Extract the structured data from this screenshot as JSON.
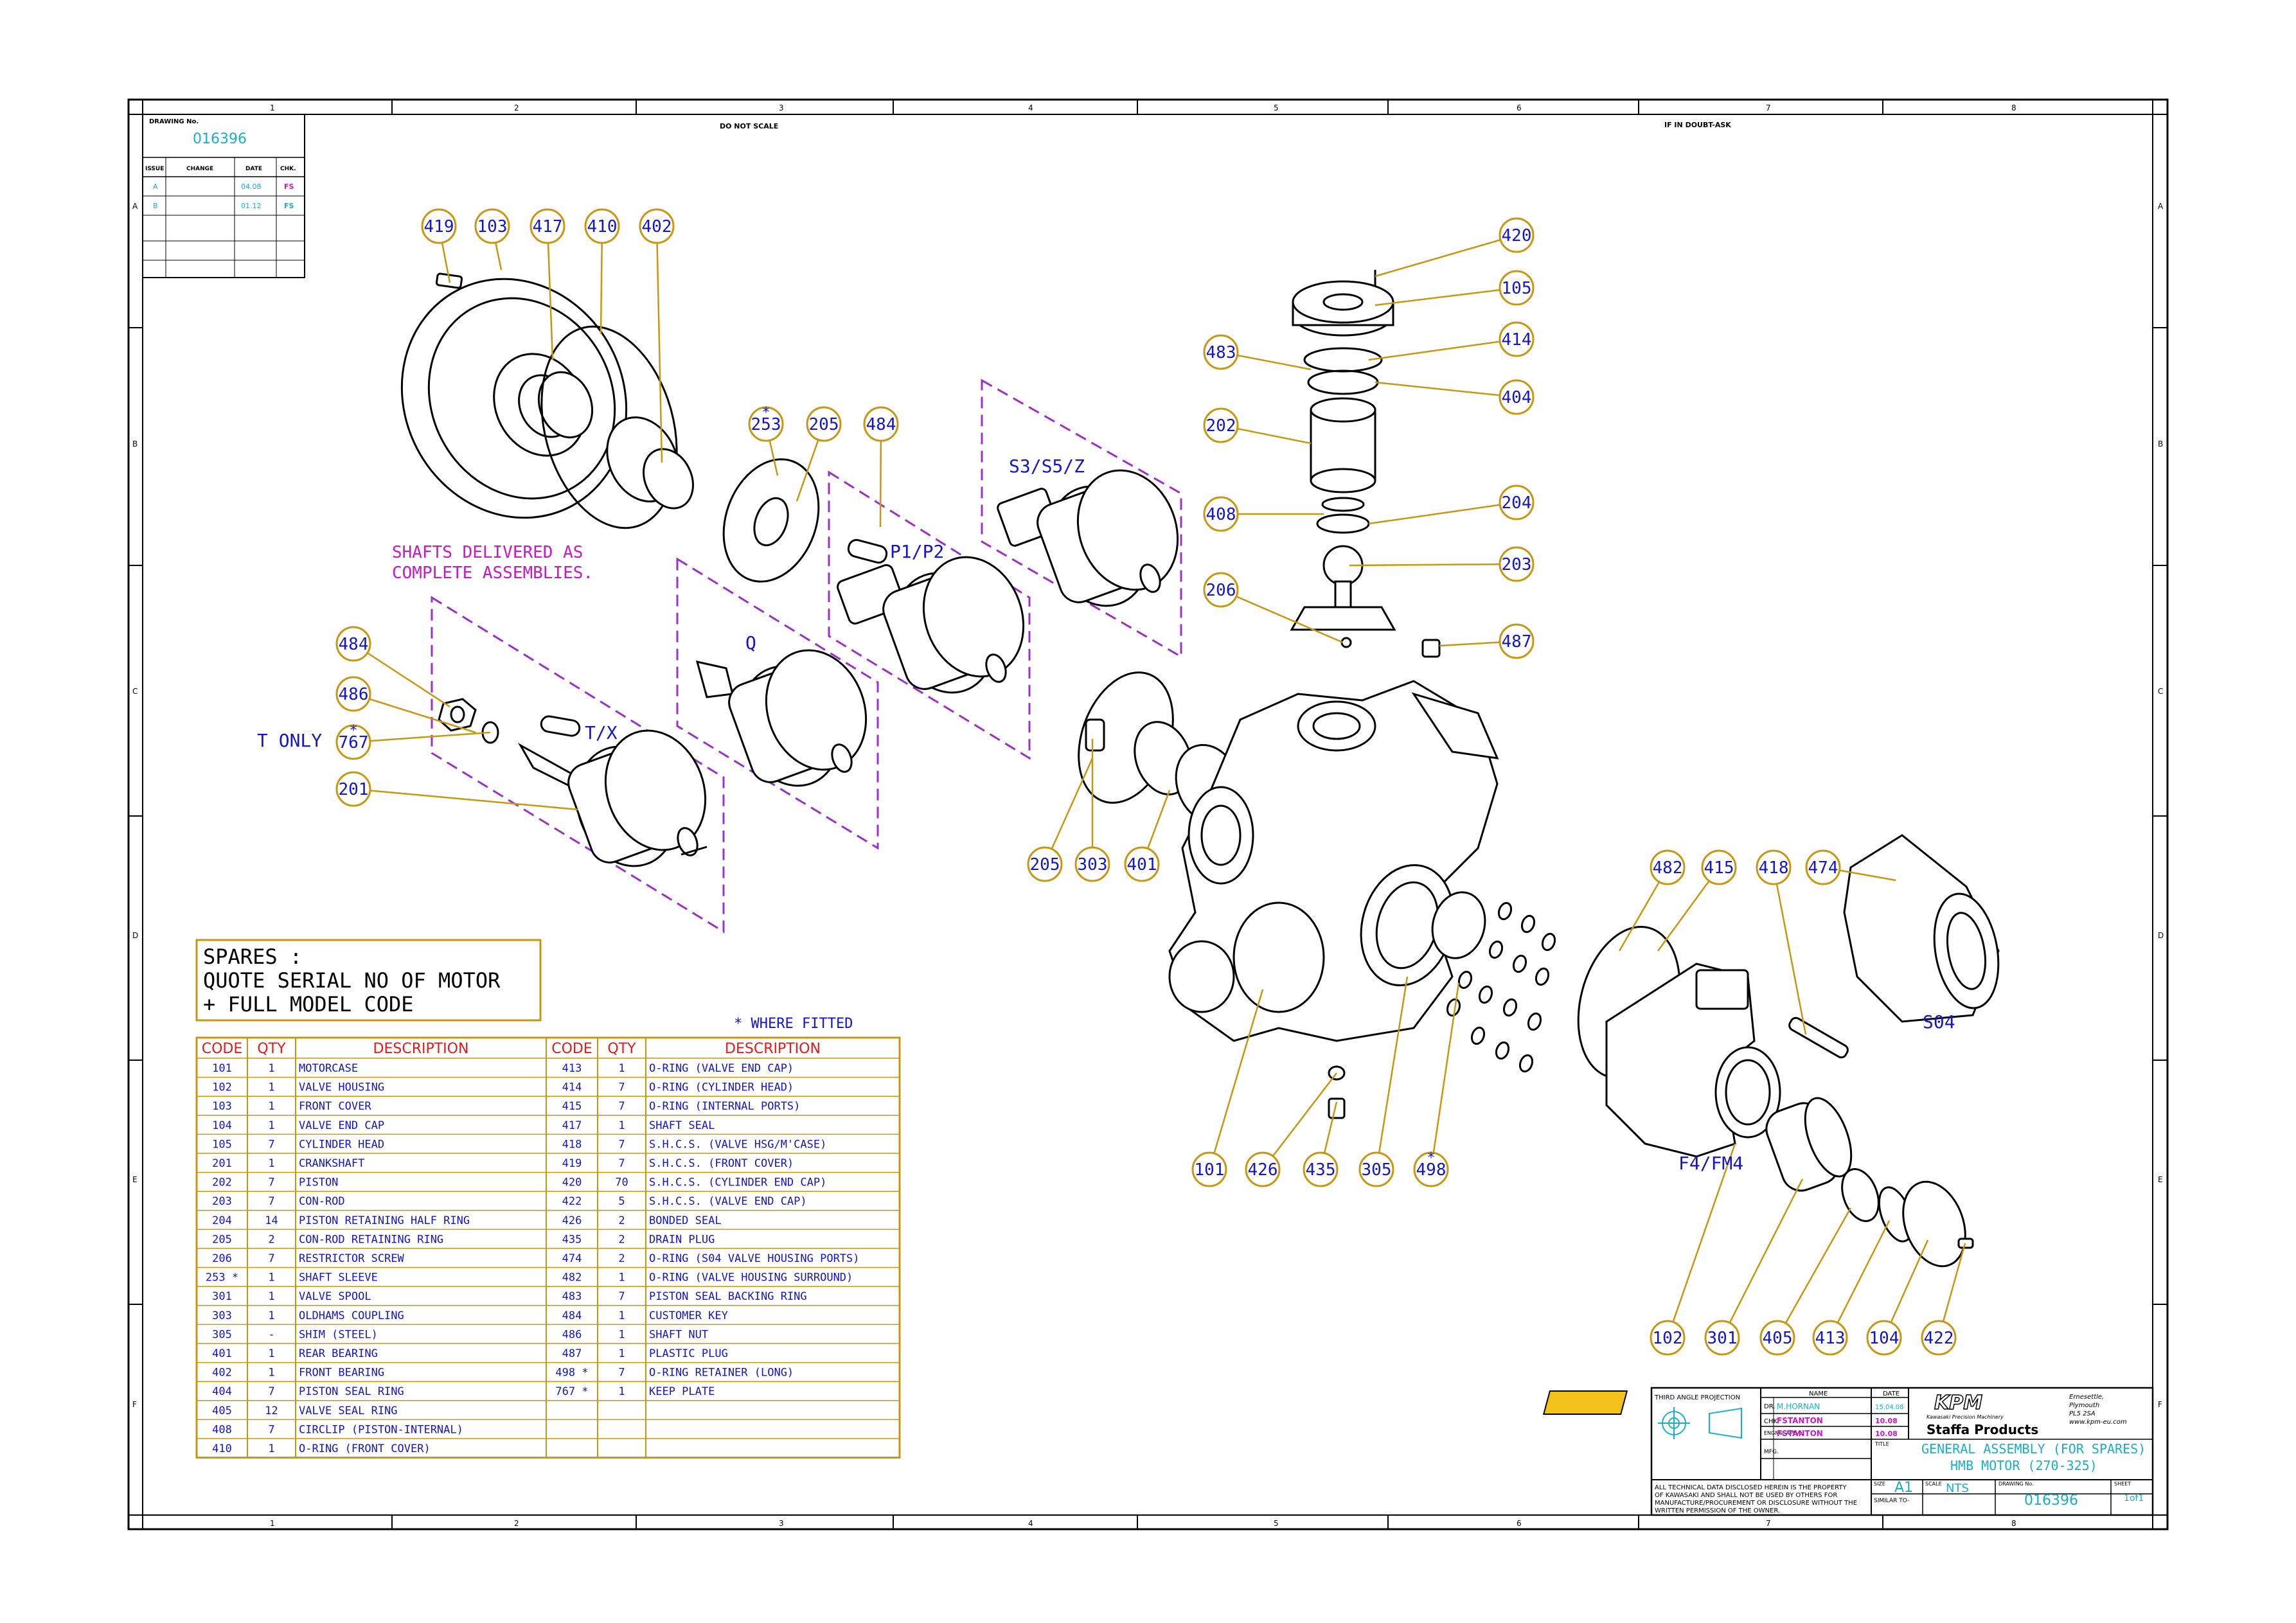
{
  "drawing_no_label": "DRAWING No.",
  "drawing_no": "016396",
  "do_not_scale": "DO NOT SCALE",
  "if_in_doubt": "IF IN DOUBT-ASK",
  "grid_columns": [
    "1",
    "2",
    "3",
    "4",
    "5",
    "6",
    "7",
    "8"
  ],
  "grid_rows": [
    "A",
    "B",
    "C",
    "D",
    "E",
    "F"
  ],
  "revision_headers": [
    "ISSUE",
    "CHANGE",
    "DATE",
    "CHK."
  ],
  "revisions": [
    {
      "issue": "A",
      "change": "",
      "date": "04.08",
      "chk": "FS"
    },
    {
      "issue": "B",
      "change": "",
      "date": "01.12",
      "chk": "FS"
    }
  ],
  "balloons": [
    {
      "id": "419",
      "star": false
    },
    {
      "id": "103",
      "star": false
    },
    {
      "id": "417",
      "star": false
    },
    {
      "id": "410",
      "star": false
    },
    {
      "id": "402",
      "star": false
    },
    {
      "id": "420",
      "star": false
    },
    {
      "id": "105",
      "star": false
    },
    {
      "id": "414",
      "star": false
    },
    {
      "id": "404",
      "star": false
    },
    {
      "id": "483",
      "star": false
    },
    {
      "id": "202",
      "star": false
    },
    {
      "id": "408",
      "star": false
    },
    {
      "id": "204",
      "star": false
    },
    {
      "id": "203",
      "star": false
    },
    {
      "id": "206",
      "star": false
    },
    {
      "id": "487",
      "star": false
    },
    {
      "id": "253",
      "star": true
    },
    {
      "id": "205",
      "star": false
    },
    {
      "id": "484",
      "star": false
    },
    {
      "id": "484",
      "star": false
    },
    {
      "id": "486",
      "star": false
    },
    {
      "id": "767",
      "star": true
    },
    {
      "id": "201",
      "star": false
    },
    {
      "id": "205",
      "star": false
    },
    {
      "id": "303",
      "star": false
    },
    {
      "id": "401",
      "star": false
    },
    {
      "id": "482",
      "star": false
    },
    {
      "id": "415",
      "star": false
    },
    {
      "id": "418",
      "star": false
    },
    {
      "id": "474",
      "star": false
    },
    {
      "id": "101",
      "star": false
    },
    {
      "id": "426",
      "star": false
    },
    {
      "id": "435",
      "star": false
    },
    {
      "id": "305",
      "star": false
    },
    {
      "id": "498",
      "star": true
    },
    {
      "id": "102",
      "star": false
    },
    {
      "id": "301",
      "star": false
    },
    {
      "id": "405",
      "star": false
    },
    {
      "id": "413",
      "star": false
    },
    {
      "id": "104",
      "star": false
    },
    {
      "id": "422",
      "star": false
    }
  ],
  "labels": {
    "shafts_note_1": "SHAFTS DELIVERED AS",
    "shafts_note_2": "COMPLETE ASSEMBLIES.",
    "s3s5z": "S3/S5/Z",
    "p1p2": "P1/P2",
    "q": "Q",
    "tx": "T/X",
    "t_only": "T ONLY",
    "s04": "S04",
    "f4fm4": "F4/FM4",
    "where_fitted": "* WHERE FITTED"
  },
  "spares_box": [
    "SPARES :",
    "QUOTE SERIAL NO OF MOTOR",
    "+ FULL MODEL CODE"
  ],
  "parts_headers": {
    "code": "CODE",
    "qty": "QTY",
    "desc": "DESCRIPTION"
  },
  "parts_left": [
    {
      "code": "101",
      "qty": "1",
      "desc": "MOTORCASE"
    },
    {
      "code": "102",
      "qty": "1",
      "desc": "VALVE HOUSING"
    },
    {
      "code": "103",
      "qty": "1",
      "desc": "FRONT COVER"
    },
    {
      "code": "104",
      "qty": "1",
      "desc": "VALVE END CAP"
    },
    {
      "code": "105",
      "qty": "7",
      "desc": "CYLINDER HEAD"
    },
    {
      "code": "201",
      "qty": "1",
      "desc": "CRANKSHAFT"
    },
    {
      "code": "202",
      "qty": "7",
      "desc": "PISTON"
    },
    {
      "code": "203",
      "qty": "7",
      "desc": "CON-ROD"
    },
    {
      "code": "204",
      "qty": "14",
      "desc": "PISTON RETAINING HALF RING"
    },
    {
      "code": "205",
      "qty": "2",
      "desc": "CON-ROD RETAINING RING"
    },
    {
      "code": "206",
      "qty": "7",
      "desc": "RESTRICTOR SCREW"
    },
    {
      "code": "253 *",
      "qty": "1",
      "desc": "SHAFT SLEEVE"
    },
    {
      "code": "301",
      "qty": "1",
      "desc": "VALVE SPOOL"
    },
    {
      "code": "303",
      "qty": "1",
      "desc": "OLDHAMS COUPLING"
    },
    {
      "code": "305",
      "qty": "-",
      "desc": "SHIM (STEEL)"
    },
    {
      "code": "401",
      "qty": "1",
      "desc": "REAR BEARING"
    },
    {
      "code": "402",
      "qty": "1",
      "desc": "FRONT BEARING"
    },
    {
      "code": "404",
      "qty": "7",
      "desc": "PISTON SEAL RING"
    },
    {
      "code": "405",
      "qty": "12",
      "desc": "VALVE SEAL RING"
    },
    {
      "code": "408",
      "qty": "7",
      "desc": "CIRCLIP (PISTON-INTERNAL)"
    },
    {
      "code": "410",
      "qty": "1",
      "desc": "O-RING (FRONT COVER)"
    }
  ],
  "parts_right": [
    {
      "code": "413",
      "qty": "1",
      "desc": "O-RING (VALVE END CAP)"
    },
    {
      "code": "414",
      "qty": "7",
      "desc": "O-RING (CYLINDER HEAD)"
    },
    {
      "code": "415",
      "qty": "7",
      "desc": "O-RING (INTERNAL PORTS)"
    },
    {
      "code": "417",
      "qty": "1",
      "desc": "SHAFT SEAL"
    },
    {
      "code": "418",
      "qty": "7",
      "desc": "S.H.C.S. (VALVE HSG/M'CASE)"
    },
    {
      "code": "419",
      "qty": "7",
      "desc": "S.H.C.S. (FRONT COVER)"
    },
    {
      "code": "420",
      "qty": "70",
      "desc": "S.H.C.S. (CYLINDER END CAP)"
    },
    {
      "code": "422",
      "qty": "5",
      "desc": "S.H.C.S. (VALVE END CAP)"
    },
    {
      "code": "426",
      "qty": "2",
      "desc": "BONDED SEAL"
    },
    {
      "code": "435",
      "qty": "2",
      "desc": "DRAIN PLUG"
    },
    {
      "code": "474",
      "qty": "2",
      "desc": "O-RING (S04 VALVE HOUSING PORTS)"
    },
    {
      "code": "482",
      "qty": "1",
      "desc": "O-RING (VALVE HOUSING SURROUND)"
    },
    {
      "code": "483",
      "qty": "7",
      "desc": "PISTON SEAL BACKING RING"
    },
    {
      "code": "484",
      "qty": "1",
      "desc": "CUSTOMER KEY"
    },
    {
      "code": "486",
      "qty": "1",
      "desc": "SHAFT NUT"
    },
    {
      "code": "487",
      "qty": "1",
      "desc": "PLASTIC PLUG"
    },
    {
      "code": "498 *",
      "qty": "7",
      "desc": "O-RING RETAINER (LONG)"
    },
    {
      "code": "767 *",
      "qty": "1",
      "desc": "KEEP PLATE"
    },
    {
      "code": "",
      "qty": "",
      "desc": ""
    },
    {
      "code": "",
      "qty": "",
      "desc": ""
    },
    {
      "code": "",
      "qty": "",
      "desc": ""
    }
  ],
  "title_block": {
    "projection": "THIRD ANGLE PROJECTION",
    "name_hdr": "NAME",
    "date_hdr": "DATE",
    "dr_label": "DR.",
    "dr_name": "M.HORNAN",
    "dr_date": "15.04.08",
    "chk_label": "CHK.",
    "chk_name": "FSTANTON",
    "chk_date": "10.08",
    "eng_label": "ENGNG. APPVL.",
    "eng_name": "FSTANTON",
    "eng_date": "10.08",
    "mfg_label": "MFG.",
    "logo": "KPM",
    "logo_sub": "Kawasaki Precision Machinery",
    "company": "Staffa Products",
    "address": [
      "Ernesettle,",
      "Plymouth",
      "PL5 2SA",
      "www.kpm-eu.com"
    ],
    "title_label": "TITLE",
    "title_1": "GENERAL ASSEMBLY (FOR SPARES)",
    "title_2": "HMB MOTOR (270-325)",
    "disclaimer": [
      "ALL TECHNICAL DATA DISCLOSED HEREIN IS THE PROPERTY",
      "OF KAWASAKI AND SHALL NOT BE USED BY OTHERS FOR",
      "MANUFACTURE/PROCUREMENT OR DISCLOSURE WITHOUT THE",
      "WRITTEN PERMISSION OF THE OWNER."
    ],
    "size_label": "SIZE",
    "size": "A1",
    "scale_label": "SCALE",
    "scale": "NTS",
    "drawing_no_label": "DRAWING No.",
    "drawing_no": "016396",
    "sheet_label": "SHEET",
    "sheet": "1of1",
    "similar_to": "SIMILAR TO-"
  },
  "colors": {
    "frame": "#000000",
    "balloon": "#c8960f",
    "balloon_text": "#1515c8",
    "dashed_box": "#9b30c8",
    "table_red": "#e61919",
    "table_blue": "#1515c8",
    "cyan": "#18b0c8",
    "magenta": "#c818c8"
  }
}
